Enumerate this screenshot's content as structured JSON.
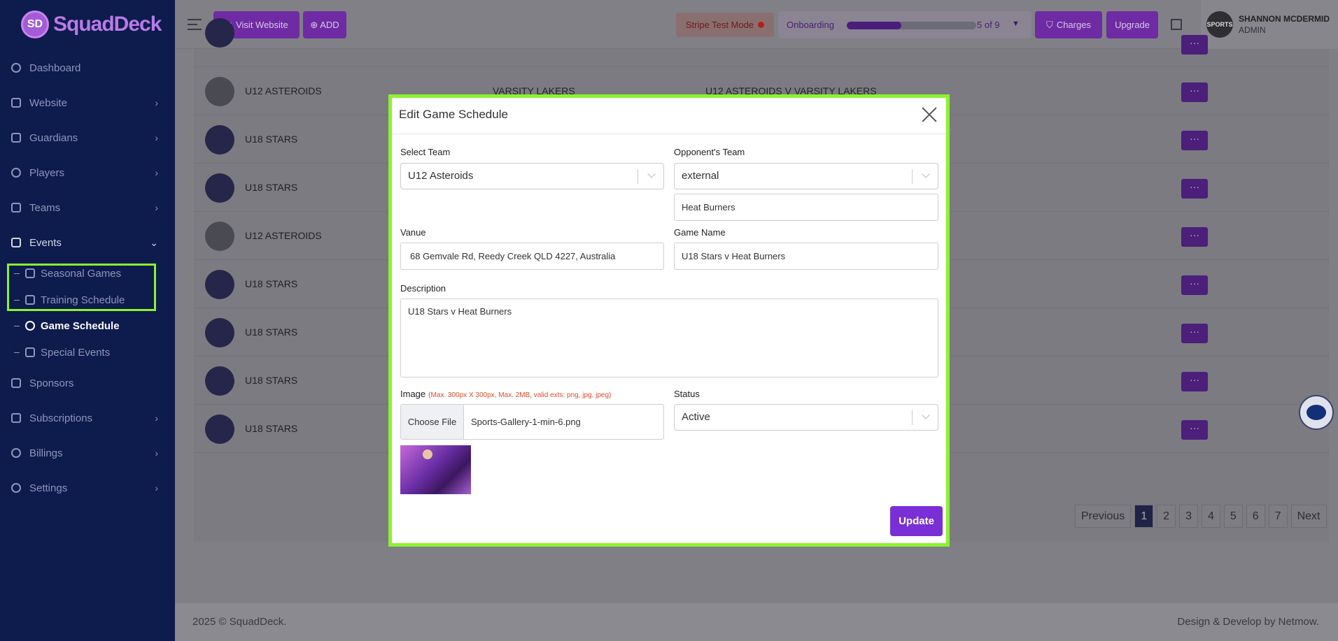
{
  "brand": {
    "logo_text": "SquadDeck",
    "logo_badge": "SD"
  },
  "sidebar": {
    "items": [
      {
        "label": "Dashboard"
      },
      {
        "label": "Website"
      },
      {
        "label": "Guardians"
      },
      {
        "label": "Players"
      },
      {
        "label": "Teams"
      },
      {
        "label": "Events"
      },
      {
        "label": "Sponsors"
      },
      {
        "label": "Subscriptions"
      },
      {
        "label": "Billings"
      },
      {
        "label": "Settings"
      }
    ],
    "events_sub": [
      {
        "label": "Seasonal Games"
      },
      {
        "label": "Training Schedule"
      },
      {
        "label": "Game Schedule"
      },
      {
        "label": "Special Events"
      }
    ]
  },
  "topbar": {
    "visit_website": "Visit Website",
    "add": "ADD",
    "stripe_mode": "Stripe Test Mode",
    "onboarding_label": "Onboarding",
    "onboarding_count": "5 of 9",
    "onboarding_progress": 0.42,
    "charges": "Charges",
    "upgrade": "Upgrade",
    "user_name": "SHANNON MCDERMID",
    "user_role": "ADMIN",
    "avatar_text": "SPORTS"
  },
  "table": {
    "rows": [
      {
        "team": "U12 ASTEROIDS",
        "photo": true
      },
      {
        "team": "U18 STARS",
        "photo": false
      },
      {
        "team": "U18 STARS",
        "photo": false
      },
      {
        "team": "U12 ASTEROIDS",
        "photo": true
      },
      {
        "team": "U18 STARS",
        "photo": false
      },
      {
        "team": "U18 STARS",
        "photo": false
      },
      {
        "team": "U18 STARS",
        "photo": false
      },
      {
        "team": "U18 STARS",
        "photo": false
      }
    ],
    "peek_opponent": "VARSITY LAKERS",
    "peek_game": "U12 ASTEROIDS V VARSITY LAKERS",
    "actions_label": "···"
  },
  "pagination": {
    "previous": "Previous",
    "pages": [
      "1",
      "2",
      "3",
      "4",
      "5",
      "6",
      "7"
    ],
    "current": "1",
    "next": "Next"
  },
  "footer": {
    "left": "2025 © SquadDeck.",
    "right": "Design & Develop by Netmow."
  },
  "modal": {
    "title": "Edit Game Schedule",
    "select_team_label": "Select Team",
    "select_team_value": "U12 Asteroids",
    "opponent_label": "Opponent's Team",
    "opponent_type": "external",
    "opponent_name": "Heat Burners",
    "venue_label": "Vanue",
    "venue_value": "68 Gemvale Rd, Reedy Creek QLD 4227, Australia",
    "game_name_label": "Game Name",
    "game_name_value": "U18 Stars v Heat Burners",
    "description_label": "Description",
    "description_value": "U18 Stars v Heat Burners",
    "image_label": "Image",
    "image_hint": "(Max. 300px X 300px, Max. 2MB, valid exts: png, jpg, jpeg)",
    "choose_file": "Choose File",
    "file_name": "Sports-Gallery-1-min-6.png",
    "status_label": "Status",
    "status_value": "Active",
    "update_button": "Update"
  },
  "colors": {
    "accent": "#7a2fd6",
    "highlight": "#8bf22e",
    "sidebar": "#0e1b4d"
  }
}
